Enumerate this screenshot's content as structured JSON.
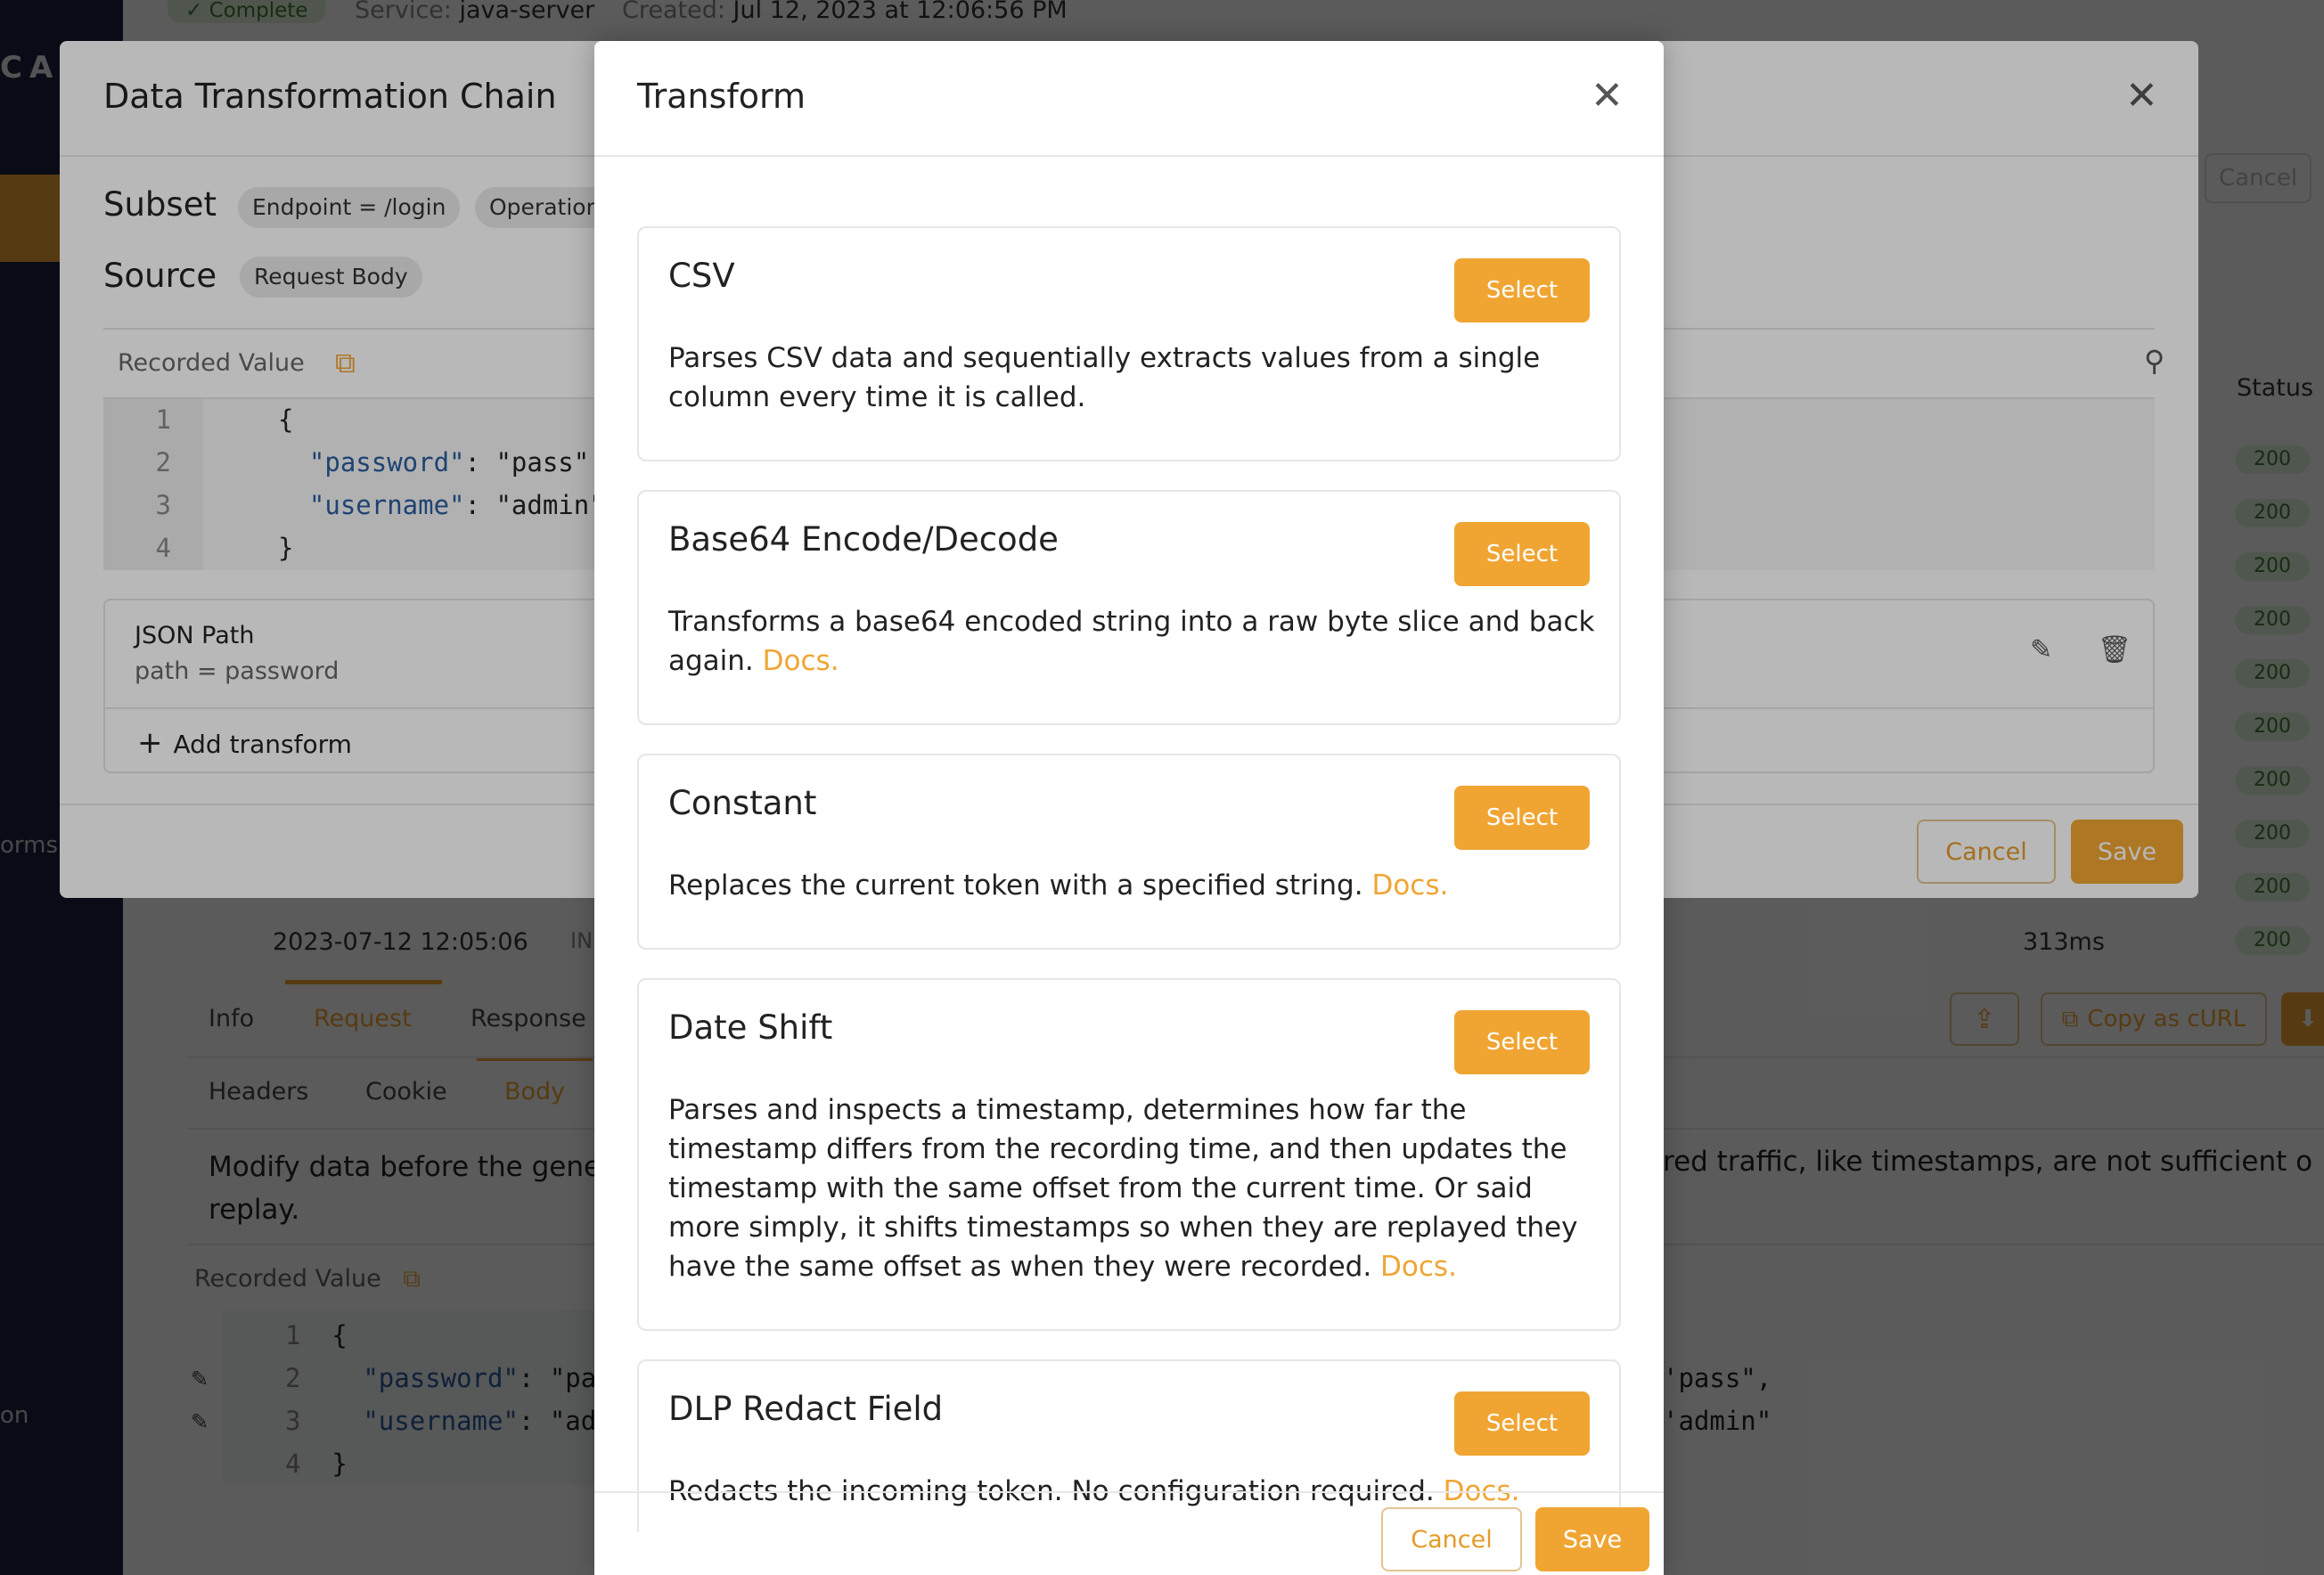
{
  "background": {
    "logo_text": "CAL",
    "sidebar_texts": [
      "orms",
      "on"
    ],
    "status_chip": "✓ Complete",
    "service_key": "Service:",
    "service_value": "java-server",
    "created_key": "Created:",
    "created_value": "Jul 12, 2023 at 12:06:56 PM",
    "cancel_label": "Cancel",
    "status_column": "Status",
    "status_badges": [
      "200",
      "200",
      "200",
      "200",
      "200",
      "200",
      "200",
      "200",
      "200",
      "200"
    ],
    "row_time": "2023-07-12 12:05:06",
    "row_in": "IN",
    "row_duration": "313ms",
    "tabs": [
      "Info",
      "Request",
      "Response"
    ],
    "subtabs": [
      "Headers",
      "Cookie",
      "Body"
    ],
    "description_left": "Modify data before the gene",
    "description_wrap": "replay.",
    "description_right": "red traffic, like timestamps, are not sufficient o",
    "recorded_value_label": "Recorded Value",
    "code_lines": [
      {
        "ln": "1",
        "text": "{"
      },
      {
        "ln": "2",
        "key": "\"password\"",
        "rest": ": \"pa"
      },
      {
        "ln": "3",
        "key": "\"username\"",
        "rest": ": \"ad"
      },
      {
        "ln": "4",
        "text": "}"
      }
    ],
    "right_values": [
      "'pass\",",
      "'admin\""
    ],
    "copy_curl_label": "Copy as cURL",
    "icons": {
      "share": "share-icon",
      "copy": "copy-icon",
      "download": "download-icon",
      "pencil": "pencil-icon"
    }
  },
  "chain_modal": {
    "title": "Data Transformation Chain",
    "subset_label": "Subset",
    "subset_chips": [
      "Endpoint = /login",
      "Operation"
    ],
    "source_label": "Source",
    "source_chip": "Request Body",
    "recorded_value_label": "Recorded Value",
    "code": [
      {
        "ln": "1",
        "text": "{"
      },
      {
        "ln": "2",
        "key": "\"password\"",
        "rest": ": \"pass\","
      },
      {
        "ln": "3",
        "key": "\"username\"",
        "rest": ": \"admin\""
      },
      {
        "ln": "4",
        "text": "}"
      }
    ],
    "transform": {
      "name": "JSON Path",
      "detail": "path = password"
    },
    "add_transform_label": "Add transform",
    "cancel_label": "Cancel",
    "save_label": "Save"
  },
  "transform_modal": {
    "title": "Transform",
    "select_label": "Select",
    "cards": [
      {
        "title": "CSV",
        "desc": "Parses CSV data and sequentially extracts values from a single column every time it is called.",
        "docs": ""
      },
      {
        "title": "Base64 Encode/Decode",
        "desc": "Transforms a base64 encoded string into a raw byte slice and back again.",
        "docs": "Docs."
      },
      {
        "title": "Constant",
        "desc": "Replaces the current token with a specified string.",
        "docs": "Docs."
      },
      {
        "title": "Date Shift",
        "desc": "Parses and inspects a timestamp, determines how far the timestamp differs from the recording time, and then updates the timestamp with the same offset from the current time. Or said more simply, it shifts timestamps so when they are replayed they have the same offset as when they were recorded.",
        "docs": "Docs."
      },
      {
        "title": "DLP Redact Field",
        "desc": "Redacts the incoming token. No configuration required.",
        "docs": "Docs."
      }
    ],
    "cancel_label": "Cancel",
    "save_label": "Save"
  },
  "colors": {
    "accent": "#f0a533",
    "sidebar": "#1b2240",
    "json_key": "#2a5d9f"
  }
}
